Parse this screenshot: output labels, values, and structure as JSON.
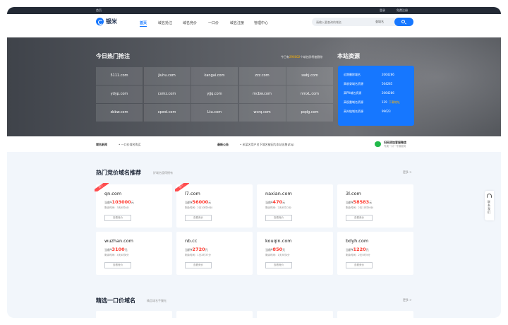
{
  "topbar": {
    "home": "首页",
    "login": "登录",
    "register": "免费注册"
  },
  "brand": {
    "name": "银米",
    "accent": "#1677ff"
  },
  "nav": [
    "首页",
    "域名抢注",
    "域名竞价",
    "一口价",
    "域名注册",
    "管理中心"
  ],
  "search": {
    "placeholder": "请输入要查询的域名",
    "type": "查域名"
  },
  "hero": {
    "title": "今日热门抢注",
    "stat_prefix": "今日有",
    "stat_count": "296002",
    "stat_suffix": "个域名即将被删除",
    "resource_title": "本站资源",
    "domains": [
      "5111.com",
      "jiuhu.com",
      "kangai.com",
      "zzz.com",
      "swbj.com",
      "ydyp.com",
      "cxmz.com",
      "yjjq.com",
      "mcbw.com",
      "nmxL.com",
      "zbbw.com",
      "xpwd.com",
      "Ltu.com",
      "wcrq.com",
      "pqdg.com"
    ],
    "resources": [
      {
        "label": "近期删除域名",
        "count": "2064286",
        "pct": ""
      },
      {
        "label": "高收录域名资源",
        "count": "564285",
        "pct": ""
      },
      {
        "label": "高PR域名资源",
        "count": "2064286",
        "pct": ""
      },
      {
        "label": "高权重域名资源",
        "count": "129",
        "pct": "下载地址"
      },
      {
        "label": "高外链域名资源",
        "count": "99623",
        "pct": ""
      }
    ]
  },
  "news": {
    "label1": "域名新闻",
    "item1": "• 一口价域名购买",
    "label2": "最新公告",
    "item2": "• 米某名用户名下域名被因为本站出售ptop",
    "wechat_main": "扫码添加客服微信",
    "wechat_sub": "专属一对一专属服务"
  },
  "auction": {
    "title": "热门竞价域名推荐",
    "sub": "好域名值得拥有",
    "more": "更多 >",
    "button": "查看竞价",
    "cards": [
      {
        "name": "qn.com",
        "price_prefix": "当前¥",
        "price": "103000",
        "unit": "元",
        "time": "剩余时间：3天4时4分",
        "hot": "热门"
      },
      {
        "name": "l7.com",
        "price_prefix": "当前¥",
        "price": "56000",
        "unit": "元",
        "time": "剩余时间：2天10时56分",
        "hot": "热门"
      },
      {
        "name": "naxian.com",
        "price_prefix": "当前¥",
        "price": "470",
        "unit": "元",
        "time": "剩余时间：2天4时12分",
        "hot": ""
      },
      {
        "name": "3l.com",
        "price_prefix": "当前¥",
        "price": "58583",
        "unit": "元",
        "time": "剩余时间：2天11时56分",
        "hot": ""
      },
      {
        "name": "wuzhan.com",
        "price_prefix": "当前¥",
        "price": "3100",
        "unit": "元",
        "time": "剩余时间：4天4时8分",
        "hot": ""
      },
      {
        "name": "nb.cc",
        "price_prefix": "当前¥",
        "price": "2720",
        "unit": "元",
        "time": "剩余时间：1天2时37分",
        "hot": ""
      },
      {
        "name": "kouqin.com",
        "price_prefix": "当前¥",
        "price": "850",
        "unit": "元",
        "time": "剩余时间：1天3时4分",
        "hot": ""
      },
      {
        "name": "bdyh.com",
        "price_prefix": "当前¥",
        "price": "1220",
        "unit": "元",
        "time": "剩余时间：2天5时5分",
        "hot": ""
      }
    ]
  },
  "fixed": {
    "title": "精选一口价域名",
    "sub": "精品域名手慢无",
    "more": "更多 >"
  },
  "float_tool": {
    "text": "联系我们"
  }
}
